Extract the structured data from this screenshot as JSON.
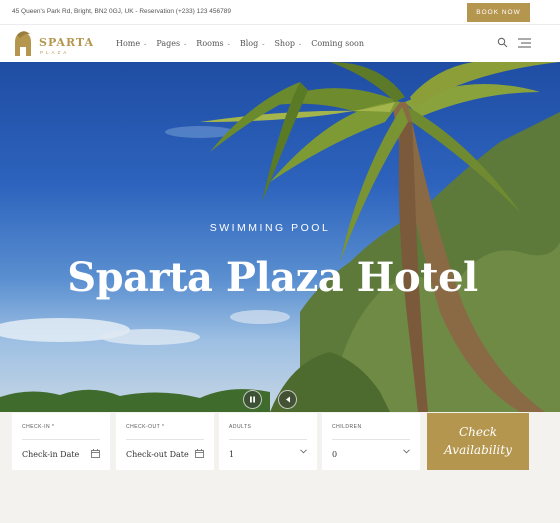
{
  "topbar": {
    "info": "45 Queen's Park Rd, Bright, BN2 0GJ, UK  -  Reservation (+233) 123 456789",
    "book_label": "BOOK NOW"
  },
  "logo": {
    "name": "SPARTA",
    "sub": "PLAZA"
  },
  "nav": {
    "items": [
      {
        "label": "Home",
        "has_dropdown": true
      },
      {
        "label": "Pages",
        "has_dropdown": true
      },
      {
        "label": "Rooms",
        "has_dropdown": true
      },
      {
        "label": "Blog",
        "has_dropdown": true
      },
      {
        "label": "Shop",
        "has_dropdown": true
      },
      {
        "label": "Coming soon",
        "has_dropdown": false
      }
    ],
    "icons": [
      "search-icon",
      "hamburger-menu-icon"
    ]
  },
  "hero": {
    "subtitle": "SWIMMING POOL",
    "title": "Sparta Plaza Hotel",
    "controls": [
      "pause-icon",
      "arrow-left-icon"
    ]
  },
  "booking": {
    "checkin": {
      "label": "CHECK-IN *",
      "value": "Check-in Date",
      "icon": "calendar-icon"
    },
    "checkout": {
      "label": "CHECK-OUT *",
      "value": "Check-out Date",
      "icon": "calendar-icon"
    },
    "adults": {
      "label": "ADULTS",
      "value": "1",
      "icon": "chevron-down-icon"
    },
    "children": {
      "label": "CHILDREN",
      "value": "0",
      "icon": "chevron-down-icon"
    },
    "submit": {
      "line1": "Check",
      "line2": "Availability"
    }
  },
  "colors": {
    "accent": "#b5964f",
    "background": "#f3f1ee"
  }
}
